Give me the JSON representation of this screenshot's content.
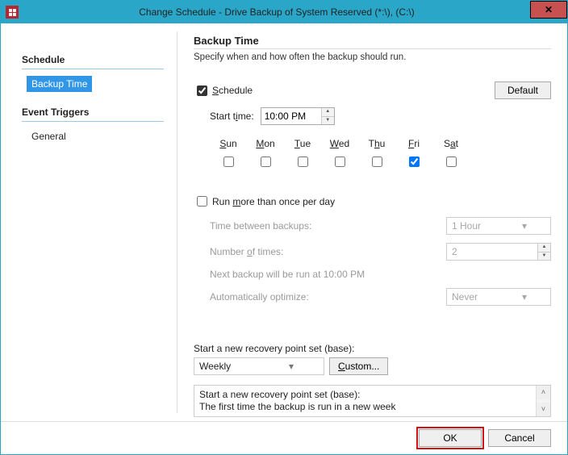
{
  "window": {
    "title": "Change Schedule - Drive Backup of System Reserved (*:\\), (C:\\)"
  },
  "sidebar": {
    "groups": [
      {
        "header": "Schedule",
        "item": "Backup Time"
      },
      {
        "header": "Event Triggers",
        "item": "General"
      }
    ]
  },
  "page": {
    "heading": "Backup Time",
    "subtitle": "Specify when and how often the backup should run."
  },
  "schedule": {
    "checkbox_label_pre": "S",
    "checkbox_label_rest": "chedule",
    "default_button": "Default",
    "start_time_label_pre": "Start t",
    "start_time_label_u": "i",
    "start_time_label_post": "me:",
    "start_time_value": "10:00 PM",
    "days": {
      "sun": {
        "label_u": "S",
        "label_rest": "un",
        "checked": false
      },
      "mon": {
        "label_u": "M",
        "label_rest": "on",
        "checked": false
      },
      "tue": {
        "label_u": "T",
        "label_rest": "ue",
        "checked": false
      },
      "wed": {
        "label_u": "W",
        "label_rest": "ed",
        "checked": false
      },
      "thu": {
        "label_pre": "T",
        "label_u": "h",
        "label_rest": "u",
        "checked": false
      },
      "fri": {
        "label_u": "F",
        "label_rest": "ri",
        "checked": true
      },
      "sat": {
        "label_pre": "S",
        "label_u": "a",
        "label_rest": "t",
        "checked": false
      }
    }
  },
  "multi": {
    "checkbox_label_pre": "Run ",
    "checkbox_label_u": "m",
    "checkbox_label_post": "ore than once per day",
    "interval_label": "Time between backups:",
    "interval_value": "1 Hour",
    "count_label_pre": "Number ",
    "count_label_u": "o",
    "count_label_post": "f times:",
    "count_value": "2",
    "next_run_text": "Next backup will be run at 10:00 PM",
    "optimize_label": "Automatically optimize:",
    "optimize_value": "Never"
  },
  "recovery": {
    "label": "Start a new recovery point set (base):",
    "select_value": "Weekly",
    "custom_button_u": "C",
    "custom_button_rest": "ustom...",
    "desc_line1": "Start a new recovery point set (base):",
    "desc_line2": "The first time the backup is run in a new week"
  },
  "footer": {
    "ok": "OK",
    "cancel": "Cancel"
  }
}
